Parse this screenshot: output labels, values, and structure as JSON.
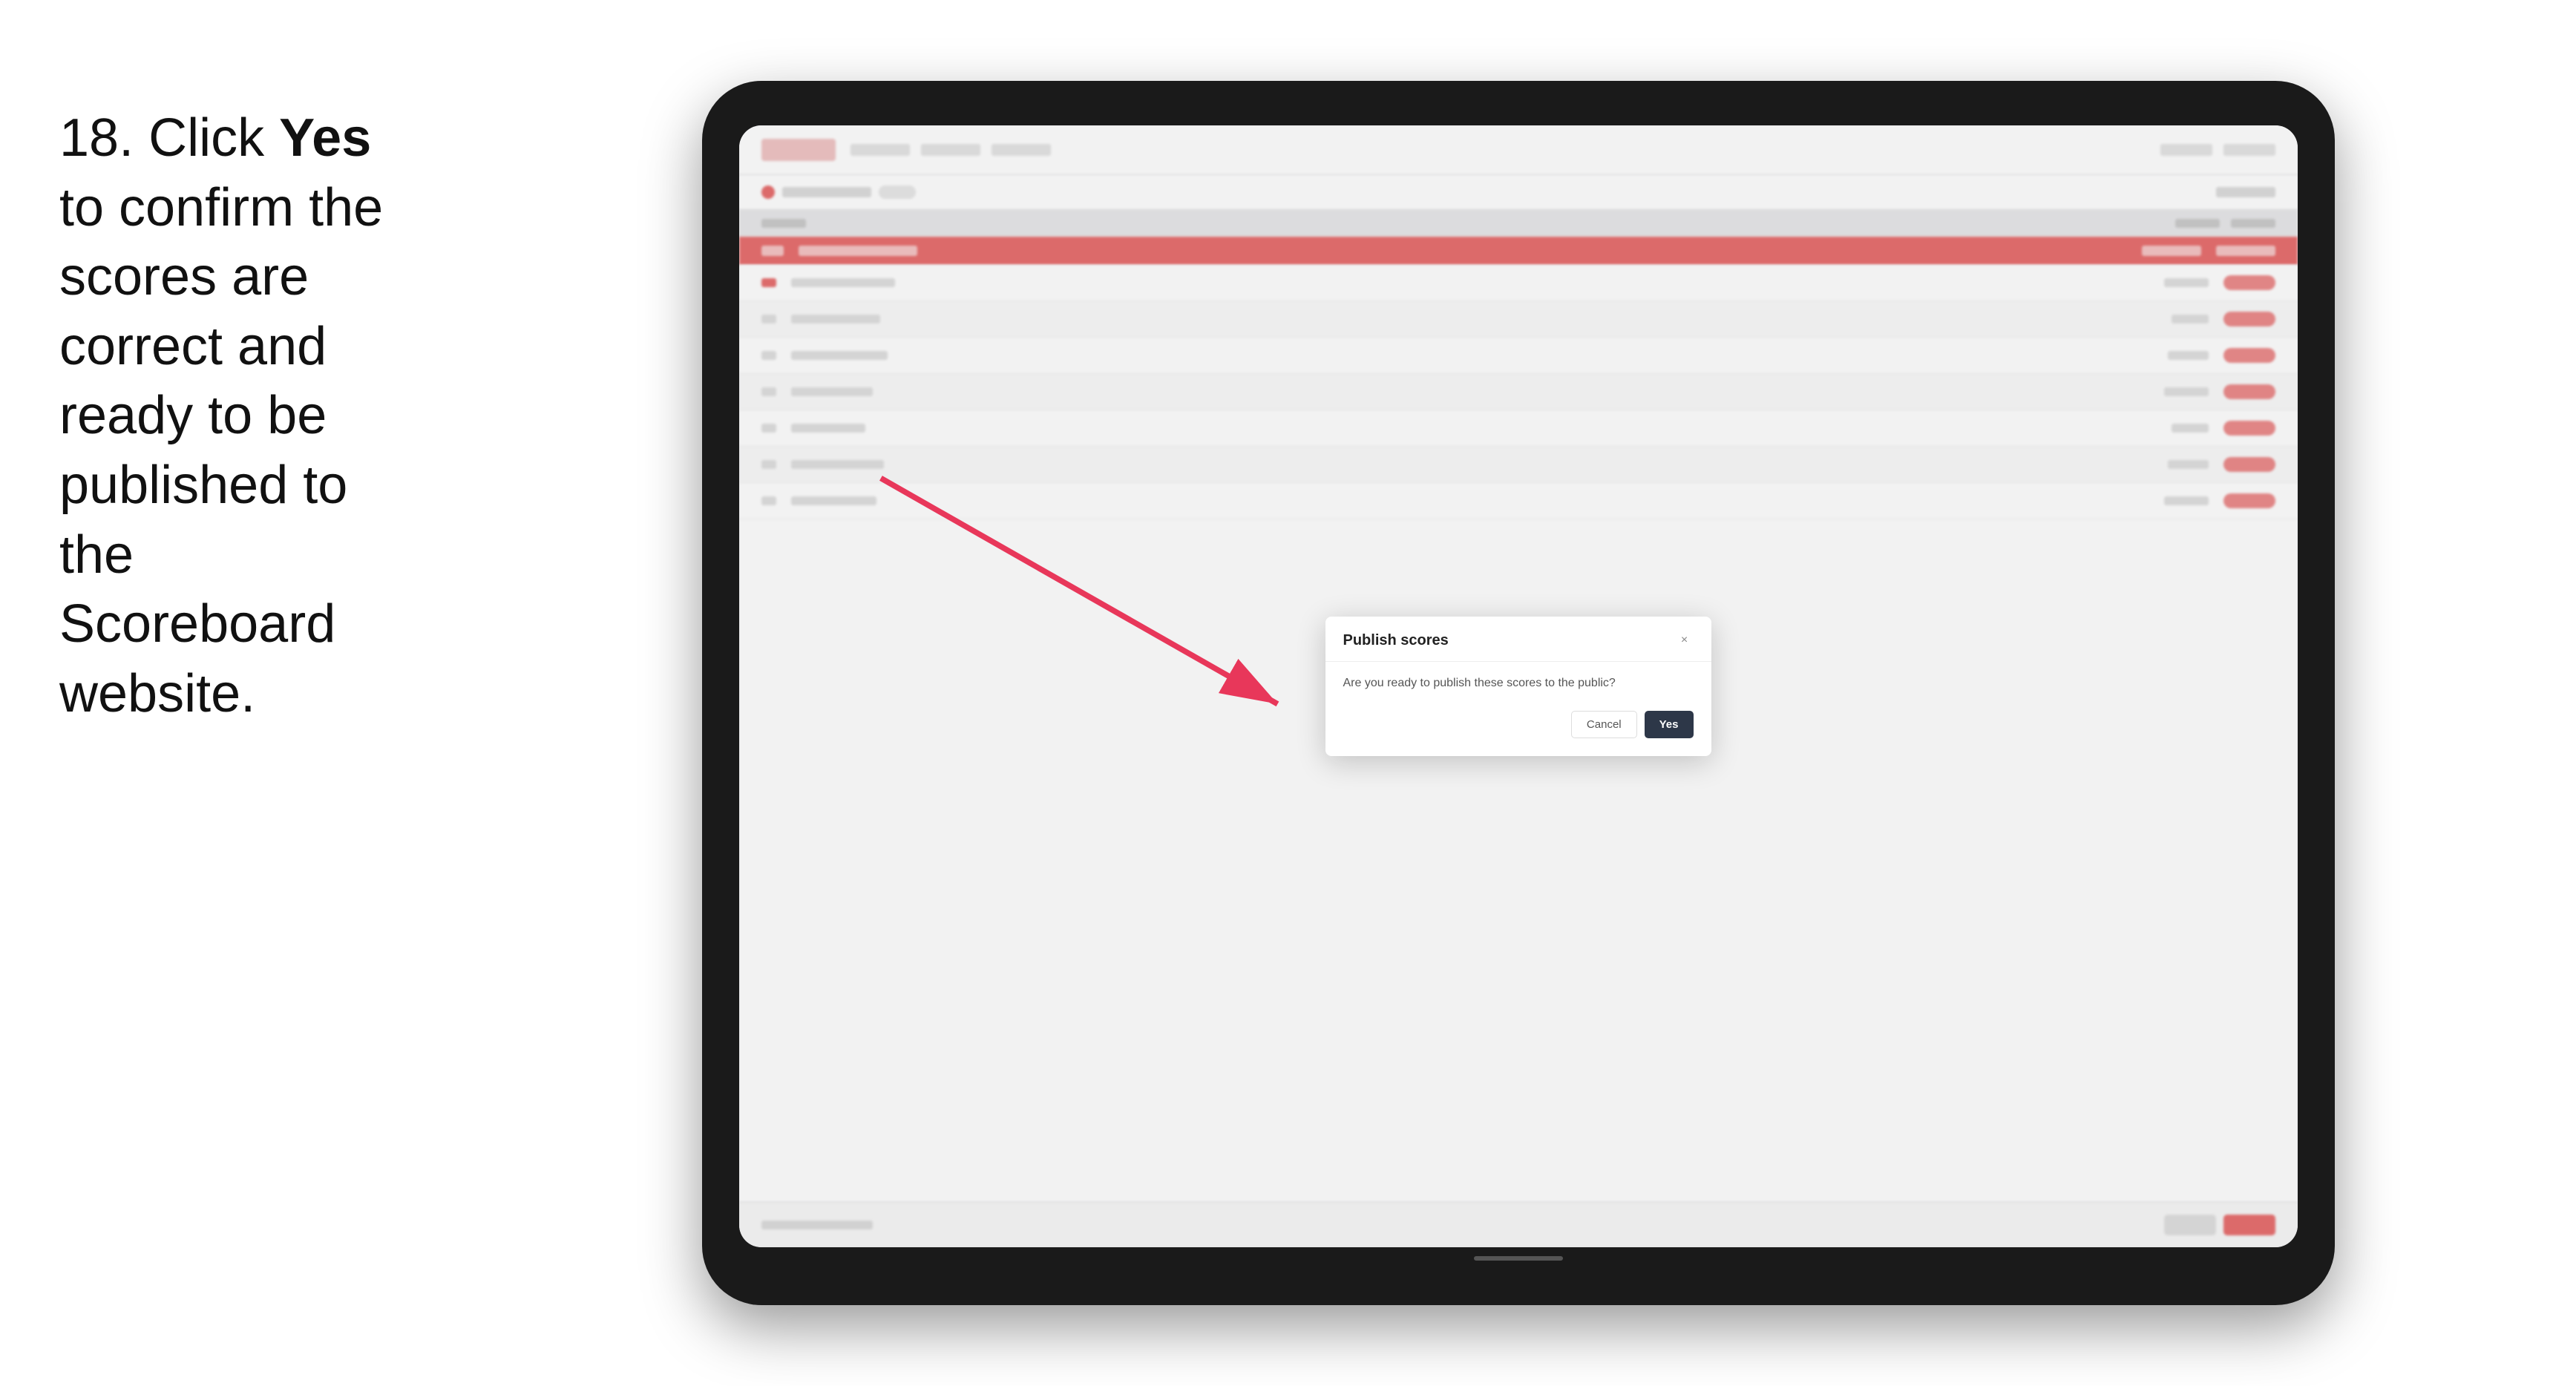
{
  "instruction": {
    "number": "18.",
    "text_parts": [
      {
        "text": "18. Click "
      },
      {
        "bold": "Yes"
      },
      {
        "text": " to confirm the scores are correct and ready to be published to the Scoreboard website."
      }
    ],
    "full_text": "18. Click Yes to confirm the scores are correct and ready to be published to the Scoreboard website."
  },
  "dialog": {
    "title": "Publish scores",
    "message": "Are you ready to publish these scores to the public?",
    "cancel_label": "Cancel",
    "yes_label": "Yes",
    "close_icon": "×"
  },
  "table": {
    "rows": 7
  },
  "colors": {
    "yes_button_bg": "#2d3748",
    "close_icon_color": "#888",
    "arrow_color": "#e8375a"
  }
}
